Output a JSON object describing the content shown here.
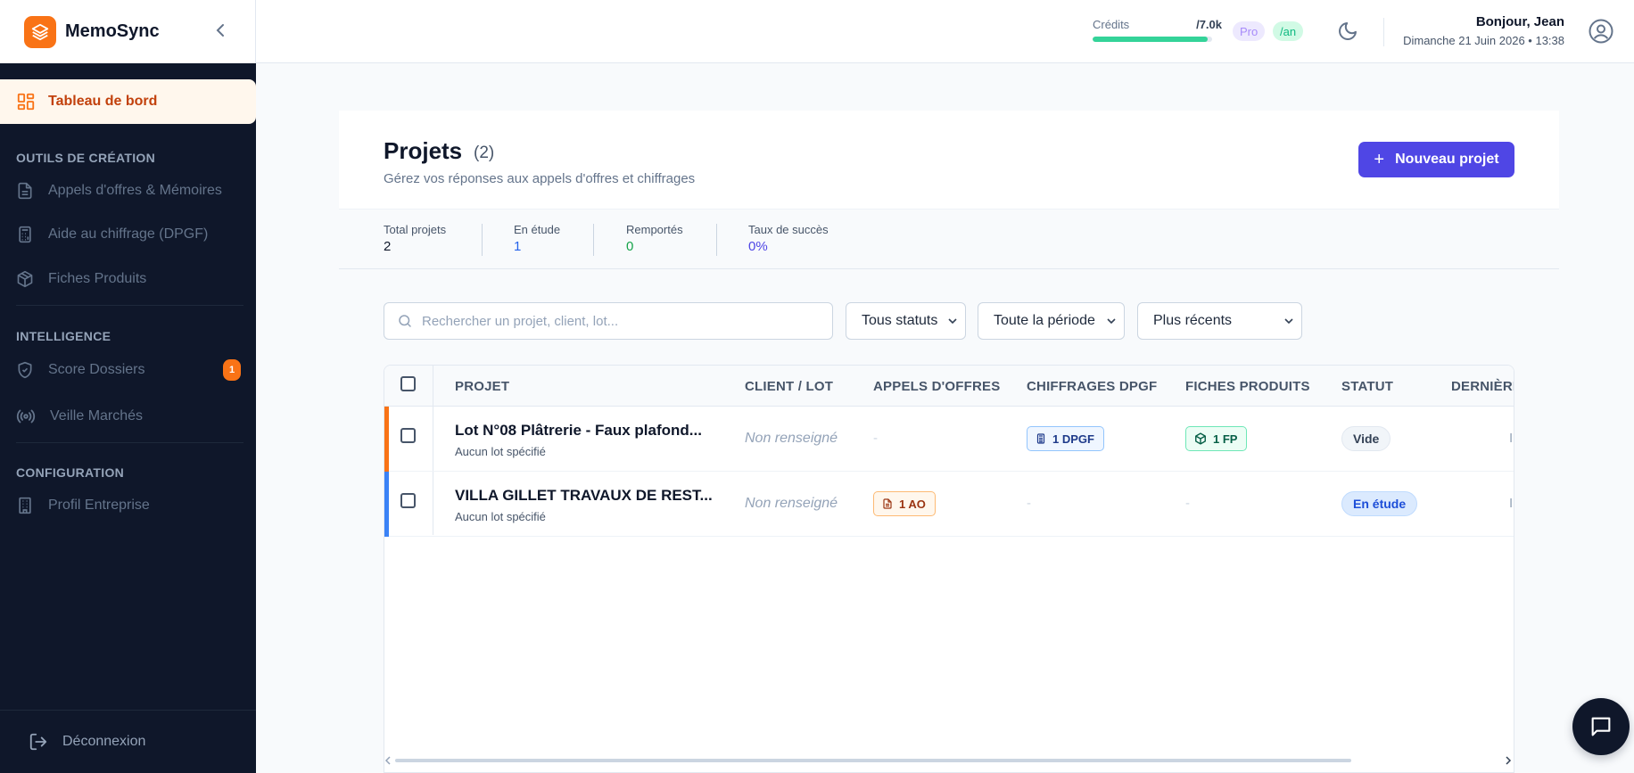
{
  "app": {
    "name": "MemoSync"
  },
  "sidebar": {
    "active": {
      "label": "Tableau de bord"
    },
    "sections": [
      {
        "title": "OUTILS DE CRÉATION",
        "items": [
          {
            "label": "Appels d'offres & Mémoires",
            "icon": "document-icon"
          },
          {
            "label": "Aide au chiffrage (DPGF)",
            "icon": "calculator-icon"
          },
          {
            "label": "Fiches Produits",
            "icon": "package-icon"
          }
        ]
      },
      {
        "title": "INTELLIGENCE",
        "items": [
          {
            "label": "Score Dossiers",
            "icon": "shield-check-icon",
            "badge": "1"
          },
          {
            "label": "Veille Marchés",
            "icon": "radio-signal-icon"
          }
        ]
      },
      {
        "title": "CONFIGURATION",
        "items": [
          {
            "label": "Profil Entreprise",
            "icon": "building-icon"
          }
        ]
      }
    ],
    "logout": "Déconnexion"
  },
  "header": {
    "credits_label": "Crédits",
    "credits_value": "/7.0k",
    "credits_fraction": 0.96,
    "plan": "Pro",
    "period": "/an",
    "greeting": "Bonjour, Jean",
    "datetime": "Dimanche 21 Juin 2026 • 13:38"
  },
  "page": {
    "title": "Projets",
    "count": "(2)",
    "subtitle": "Gérez vos réponses aux appels d'offres et chiffrages",
    "new_button": "Nouveau projet"
  },
  "stats": [
    {
      "label": "Total projets",
      "value": "2",
      "color": "#0f172a"
    },
    {
      "label": "En étude",
      "value": "1",
      "color": "#2563eb"
    },
    {
      "label": "Remportés",
      "value": "0",
      "color": "#16a34a"
    },
    {
      "label": "Taux de succès",
      "value": "0%",
      "color": "#4f46e5"
    }
  ],
  "filters": {
    "search_placeholder": "Rechercher un projet, client, lot...",
    "status": "Tous statuts",
    "period": "Toute la période",
    "sort": "Plus récents"
  },
  "table": {
    "columns": [
      "PROJET",
      "CLIENT / LOT",
      "APPELS D'OFFRES",
      "CHIFFRAGES DPGF",
      "FICHES PRODUITS",
      "STATUT",
      "DERNIÈRE"
    ],
    "rows": [
      {
        "title": "Lot N°08 Plâtrerie - Faux plafond...",
        "subtitle": "Aucun lot spécifié",
        "client": "Non renseigné",
        "ao": "-",
        "dpgf": "1 DPGF",
        "fp": "1 FP",
        "status": "Vide",
        "last": "Il",
        "accent": "#f97316"
      },
      {
        "title": "VILLA GILLET TRAVAUX DE REST...",
        "subtitle": "Aucun lot spécifié",
        "client": "Non renseigné",
        "ao": "1 AO",
        "dpgf": "-",
        "fp": "-",
        "status": "En étude",
        "last": "Il",
        "accent": "#3b82f6"
      }
    ]
  }
}
